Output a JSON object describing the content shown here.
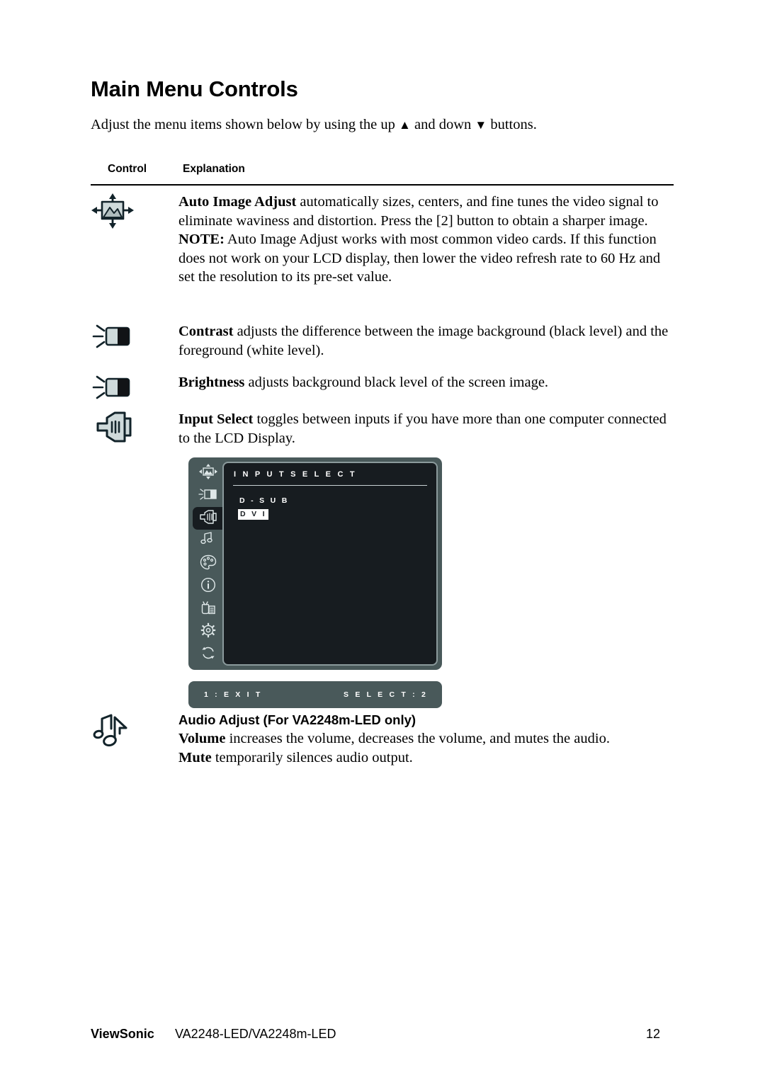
{
  "document": {
    "title": "Main Menu Controls",
    "intro_prefix": "Adjust the menu items shown below by using the up ",
    "intro_up_glyph": "▲",
    "intro_middle": " and down ",
    "intro_down_glyph": "▼",
    "intro_suffix": " buttons."
  },
  "table": {
    "headers": {
      "control": "Control",
      "explanation": "Explanation"
    }
  },
  "rows": {
    "auto_image_adjust": {
      "icon": "auto-image-adjust-icon",
      "term": "Auto Image Adjust",
      "body": " automatically sizes, centers, and fine tunes the video signal to eliminate waviness and distortion. Press the [2] button to obtain a sharper image.",
      "note_label": "NOTE:",
      "note_body": " Auto Image Adjust works with most common video cards. If this function does not work on your LCD display, then lower the video refresh rate to 60 Hz and set the resolution to its pre-set value."
    },
    "contrast": {
      "icon": "contrast-icon",
      "term": "Contrast",
      "body": " adjusts the difference between the image background  (black level) and the foreground (white level)."
    },
    "brightness": {
      "icon": "brightness-icon",
      "term": "Brightness",
      "body": " adjusts background black level of the screen image."
    },
    "input_select": {
      "icon": "input-select-icon",
      "term": "Input Select",
      "body": " toggles between inputs if you have more than one computer connected to the LCD Display."
    },
    "audio_adjust": {
      "icon": "audio-adjust-icon",
      "heading": "Audio Adjust (For VA2248m-LED only)",
      "volume_term": "Volume",
      "volume_body": " increases the volume, decreases the volume, and mutes the audio.",
      "mute_term": "Mute",
      "mute_body": " temporarily silences audio output."
    }
  },
  "osd": {
    "title": "I N P U T    S E L E C T",
    "options": [
      {
        "label": "D - S U B",
        "selected": false
      },
      {
        "label": "D V I",
        "selected": true
      }
    ],
    "sidebar_icons": [
      "osd-auto-image-adjust-icon",
      "osd-contrast-brightness-icon",
      "osd-input-select-icon",
      "osd-audio-adjust-icon",
      "osd-color-adjust-icon",
      "osd-information-icon",
      "osd-manual-image-adjust-icon",
      "osd-setup-menu-icon",
      "osd-memory-recall-icon"
    ],
    "selected_sidebar_index": 2,
    "footer_left": "1 : E X I T",
    "footer_right": "S E L E C T : 2",
    "colors": {
      "sidebar_bg": "#49595a",
      "panel_bg": "#171c20",
      "panel_border": "#8b9a9c",
      "text": "#ffffff"
    }
  },
  "footer": {
    "brand": "ViewSonic",
    "model": "VA2248-LED/VA2248m-LED",
    "page_number": "12"
  }
}
